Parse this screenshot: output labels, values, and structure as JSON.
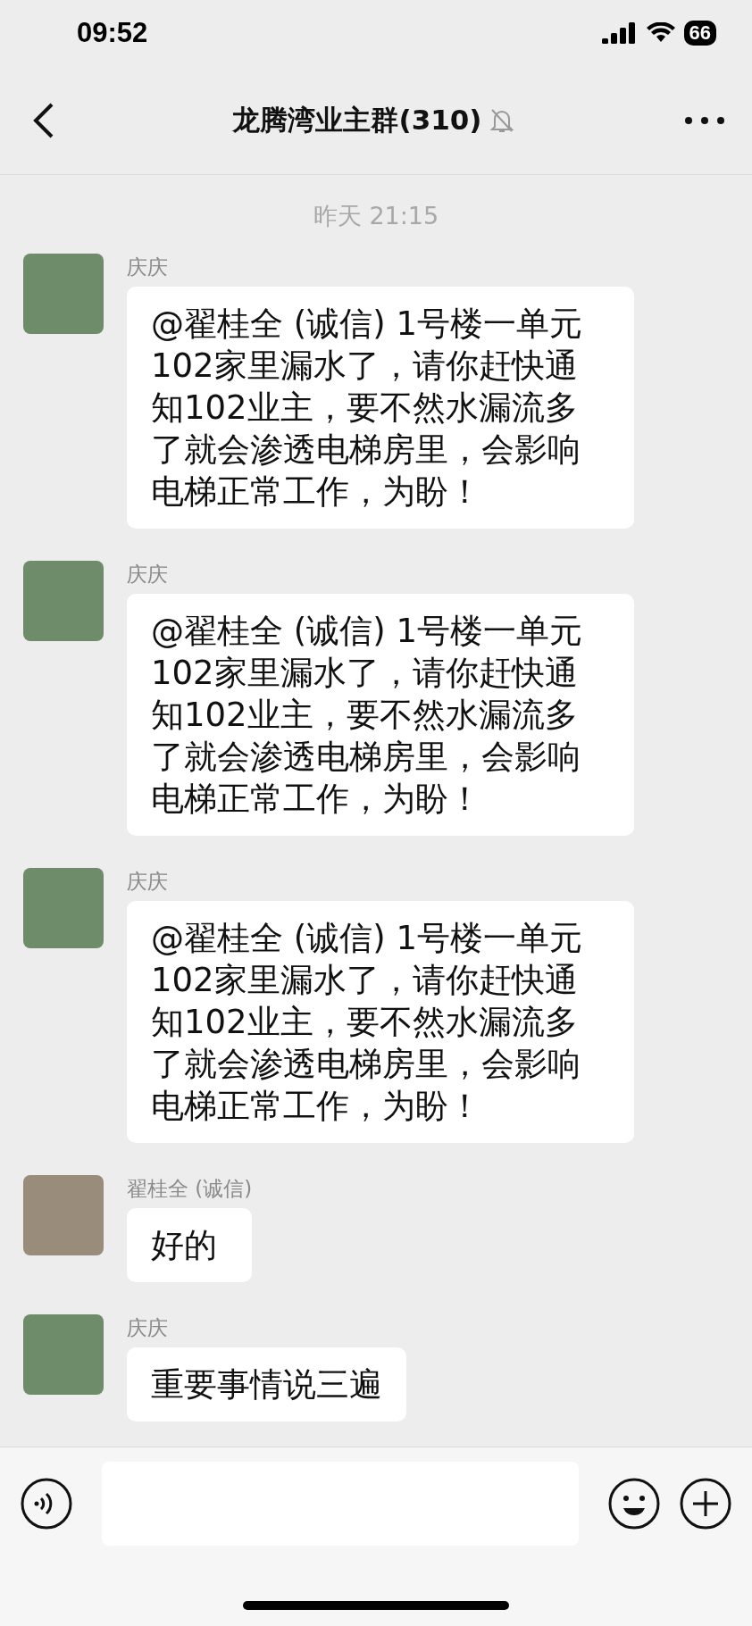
{
  "status_bar": {
    "time": "09:52",
    "battery": "66"
  },
  "header": {
    "title": "龙腾湾业主群(310)",
    "muted": true
  },
  "timestamp": "昨天 21:15",
  "messages": [
    {
      "sender": "庆庆",
      "text": "@翟桂全 (诚信) 1号楼一单元102家里漏水了，请你赶快通知102业主，要不然水漏流多了就会渗透电梯房里，会影响电梯正常工作，为盼！"
    },
    {
      "sender": "庆庆",
      "text": "@翟桂全 (诚信) 1号楼一单元102家里漏水了，请你赶快通知102业主，要不然水漏流多了就会渗透电梯房里，会影响电梯正常工作，为盼！"
    },
    {
      "sender": "庆庆",
      "text": "@翟桂全 (诚信) 1号楼一单元102家里漏水了，请你赶快通知102业主，要不然水漏流多了就会渗透电梯房里，会影响电梯正常工作，为盼！"
    },
    {
      "sender": "翟桂全 (诚信)",
      "text": "好的"
    },
    {
      "sender": "庆庆",
      "text": "重要事情说三遍"
    }
  ]
}
